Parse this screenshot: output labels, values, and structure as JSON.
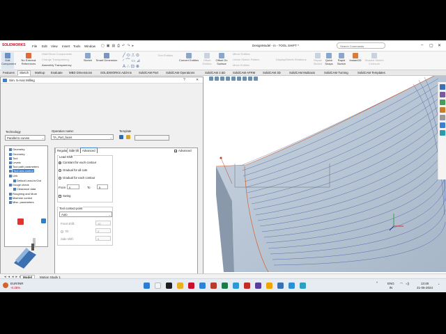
{
  "titlebar": {
    "app_name": "SOLIDWORKS",
    "menus": [
      "File",
      "Edit",
      "View",
      "Insert",
      "Tools",
      "Window"
    ],
    "document_title": "DesignModel - in - TOOL SHIFT *",
    "search_placeholder": "Search Commands"
  },
  "toolbar": {
    "edit_component": "Edit\nComponent",
    "no_external_references": "No External\nReferences",
    "hide_show_components": "Hide/Show Components",
    "change_transparency": "Change Transparency",
    "assembly_transparency": "Assembly Transparency",
    "sketch": "Sketch",
    "smart_dimension": "Smart Dimension",
    "trim_entities": "Trim Entities",
    "convert_entities": "Convert Entities",
    "offset_entities": "Offset\nEntities",
    "offset_on_surface": "Offset On\nSurface",
    "mirror_entities": "Mirror Entities",
    "linear_sketch_pattern": "Linear Sketch Pattern",
    "move_entities": "Move Entities",
    "display_delete_relations": "Display/Delete Relations",
    "repair_sketch": "Repair\nSketch",
    "quick_snaps": "Quick\nSnaps",
    "rapid_sketch": "Rapid\nSketch",
    "instant2d": "Instant2D",
    "shaded_sketch_contours": "Shaded Sketch\nContours"
  },
  "tabs": [
    "Features",
    "Sketch",
    "Markup",
    "Evaluate",
    "MBD Dimensions",
    "SOLIDWORKS Add-Ins",
    "SolidCAM Part",
    "SolidCAM Operations",
    "SolidCAM 2.5D",
    "SolidCAM AFRM",
    "SolidCAM 3D",
    "SolidCAM Multiaxis",
    "SolidCAM Turning",
    "SolidCAM Templates"
  ],
  "active_tab": "Sketch",
  "dialog": {
    "title": "Sim. 5-Axis Milling",
    "technology_label": "Technology",
    "technology_value": "Parallel to curves",
    "operation_name_label": "Operation name:",
    "operation_name_value": "TA_Part_faces",
    "template_label": "Template",
    "tree": [
      {
        "label": "Geometry"
      },
      {
        "label": "Geometry"
      },
      {
        "label": "Tool"
      },
      {
        "label": "Levels"
      },
      {
        "label": "Tool path parameters"
      },
      {
        "label": "Tool axis control"
      },
      {
        "label": "Link"
      },
      {
        "label": "Default Lead-In/Out"
      },
      {
        "label": "Gouge check"
      },
      {
        "label": "Clearance data"
      },
      {
        "label": "Roughing and More"
      },
      {
        "label": "Machine control"
      },
      {
        "label": "Misc. parameters"
      }
    ],
    "tree_selected_index": 5,
    "panel_tabs": [
      "Regular",
      "Side tilt",
      "Advanced"
    ],
    "advanced_checkbox": "Advanced",
    "lead_shift_label": "Lead Shift",
    "radio_options": [
      "Constant for each contour",
      "Gradual for all cuts",
      "Gradual for each contour"
    ],
    "radio_selected": 0,
    "from_label": "From",
    "from_value": "0",
    "to_label": "To",
    "to_value": "5",
    "swing_label": "Swing",
    "tool_contact_point_label": "Tool contact point",
    "contact_value": "Auto",
    "front_shift_label": "Front shift:",
    "front_shift_value": "10",
    "tilt_label": "Tilt:",
    "tilt_value": "0",
    "side_shift_label": "Side shift:",
    "side_shift_value": "0"
  },
  "bottom_tabs": [
    "Model",
    "Motion Study 1"
  ],
  "bottom_active": "Model",
  "status": {
    "version": "SOLIDWORKS 2024 SP2.0",
    "mode": "Editing Part",
    "units": "Custom"
  },
  "taskbar": {
    "ticker_name": "EUR/INR",
    "ticker_change": "-0.35%",
    "language": "ENG",
    "region": "IN",
    "time": "13:48",
    "date": "21-06-2024"
  },
  "colors": {
    "accent": "#c8102e",
    "selection": "#3f7fd0",
    "part_face": "#b8c6d6",
    "toolpath_line": "#2b4a9f",
    "orange_curve": "#d4622a"
  }
}
